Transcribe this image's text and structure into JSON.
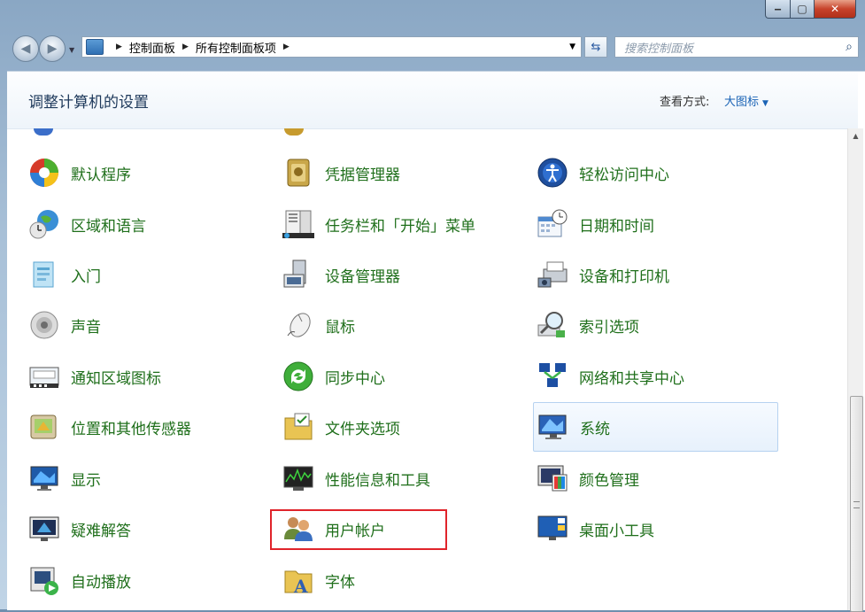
{
  "window": {
    "caption_buttons": {
      "minimize": "‒",
      "maximize": "▢",
      "close": "✕"
    }
  },
  "nav": {
    "breadcrumb": [
      "控制面板",
      "所有控制面板项"
    ],
    "search_placeholder": "搜索控制面板"
  },
  "header": {
    "title": "调整计算机的设置",
    "view_by_label": "查看方式:",
    "view_by_value": "大图标"
  },
  "items": {
    "col1": [
      {
        "label": "默认程序",
        "icon": "default-programs-icon"
      },
      {
        "label": "区域和语言",
        "icon": "region-language-icon"
      },
      {
        "label": "入门",
        "icon": "getting-started-icon"
      },
      {
        "label": "声音",
        "icon": "sound-icon"
      },
      {
        "label": "通知区域图标",
        "icon": "notification-area-icon"
      },
      {
        "label": "位置和其他传感器",
        "icon": "location-sensors-icon"
      },
      {
        "label": "显示",
        "icon": "display-icon"
      },
      {
        "label": "疑难解答",
        "icon": "troubleshooting-icon"
      },
      {
        "label": "自动播放",
        "icon": "autoplay-icon"
      }
    ],
    "col2": [
      {
        "label": "凭据管理器",
        "icon": "credential-manager-icon"
      },
      {
        "label": "任务栏和「开始」菜单",
        "icon": "taskbar-start-menu-icon"
      },
      {
        "label": "设备管理器",
        "icon": "device-manager-icon"
      },
      {
        "label": "鼠标",
        "icon": "mouse-icon"
      },
      {
        "label": "同步中心",
        "icon": "sync-center-icon"
      },
      {
        "label": "文件夹选项",
        "icon": "folder-options-icon"
      },
      {
        "label": "性能信息和工具",
        "icon": "performance-icon"
      },
      {
        "label": "用户帐户",
        "icon": "user-accounts-icon"
      },
      {
        "label": "字体",
        "icon": "fonts-icon"
      }
    ],
    "col3": [
      {
        "label": "轻松访问中心",
        "icon": "ease-of-access-icon"
      },
      {
        "label": "日期和时间",
        "icon": "date-time-icon"
      },
      {
        "label": "设备和打印机",
        "icon": "devices-printers-icon"
      },
      {
        "label": "索引选项",
        "icon": "indexing-options-icon"
      },
      {
        "label": "网络和共享中心",
        "icon": "network-sharing-icon"
      },
      {
        "label": "系统",
        "icon": "system-icon"
      },
      {
        "label": "颜色管理",
        "icon": "color-management-icon"
      },
      {
        "label": "桌面小工具",
        "icon": "desktop-gadgets-icon"
      }
    ]
  },
  "colors": {
    "link_green": "#1f6f1b",
    "title_blue": "#1e395b",
    "highlight_red": "#e0242b"
  }
}
